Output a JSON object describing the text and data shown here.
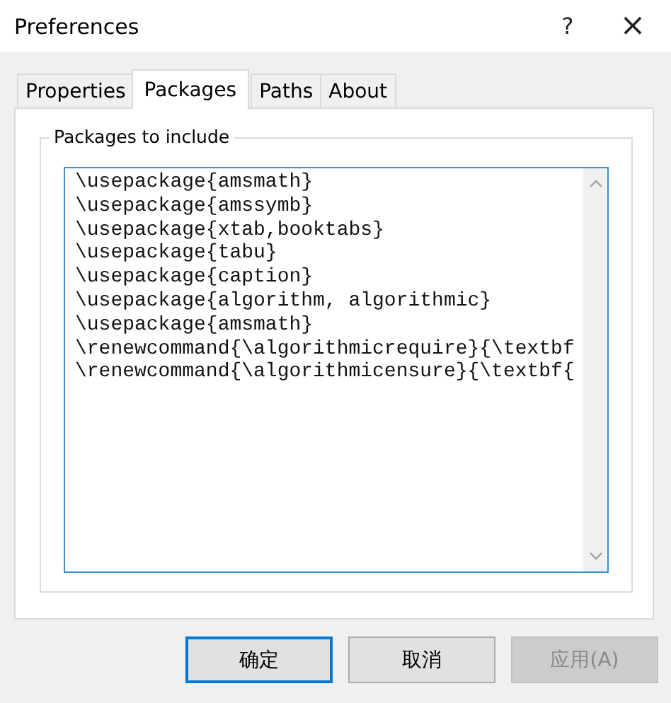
{
  "window": {
    "title": "Preferences",
    "help": "?",
    "close": "×"
  },
  "tabs": [
    {
      "label": "Properties",
      "selected": false
    },
    {
      "label": "Packages",
      "selected": true
    },
    {
      "label": "Paths",
      "selected": false
    },
    {
      "label": "About",
      "selected": false
    }
  ],
  "group": {
    "title": "Packages to include",
    "lines": [
      "\\usepackage{amsmath}",
      "\\usepackage{amssymb}",
      "\\usepackage{xtab,booktabs}",
      "\\usepackage{tabu}",
      "\\usepackage{caption}",
      "\\usepackage{algorithm, algorithmic}",
      "\\usepackage{amsmath}",
      "\\renewcommand{\\algorithmicrequire}{\\textbf",
      "\\renewcommand{\\algorithmicensure}{\\textbf{"
    ]
  },
  "buttons": [
    {
      "label": "确定",
      "default": true,
      "disabled": false
    },
    {
      "label": "取消",
      "default": false,
      "disabled": false
    },
    {
      "label": "应用(A)",
      "default": false,
      "disabled": true
    }
  ]
}
